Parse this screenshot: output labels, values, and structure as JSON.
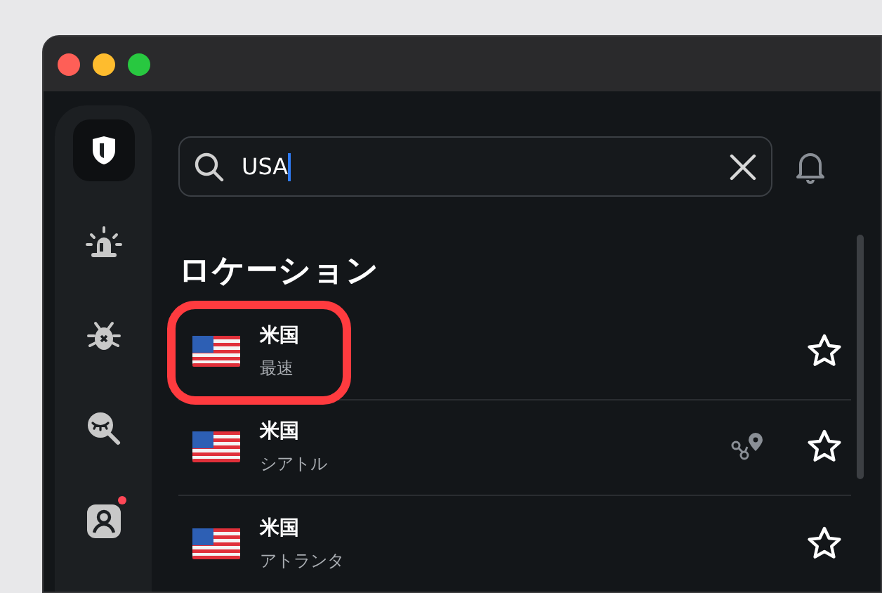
{
  "sidebar": {
    "items": [
      {
        "kind": "shield",
        "selected": true,
        "badge": false
      },
      {
        "kind": "alarm",
        "selected": false,
        "badge": false
      },
      {
        "kind": "bug",
        "selected": false,
        "badge": false
      },
      {
        "kind": "eye",
        "selected": false,
        "badge": false
      },
      {
        "kind": "profile",
        "selected": false,
        "badge": true
      }
    ]
  },
  "search": {
    "value": "USA"
  },
  "section_title": "ロケーション",
  "locations": [
    {
      "country": "米国",
      "city": "最速",
      "route_icon": false,
      "favorite": false,
      "highlighted": true
    },
    {
      "country": "米国",
      "city": "シアトル",
      "route_icon": true,
      "favorite": false,
      "highlighted": false
    },
    {
      "country": "米国",
      "city": "アトランタ",
      "route_icon": false,
      "favorite": false,
      "highlighted": false
    }
  ]
}
